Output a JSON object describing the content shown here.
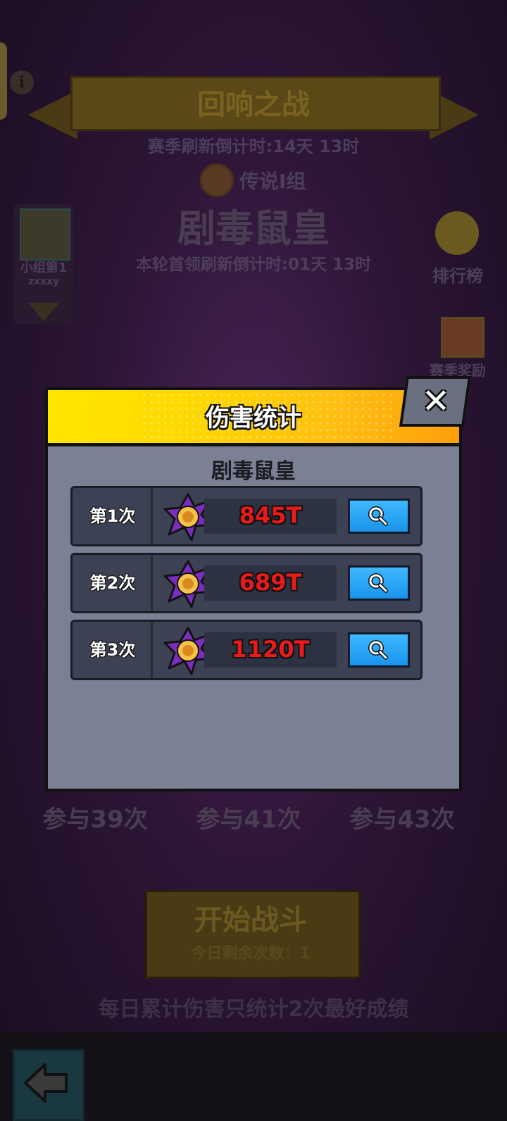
{
  "background": {
    "banner_title": "回响之战",
    "season_countdown": "赛季刷新倒计时:14天 13时",
    "group_label": "传说I组",
    "boss_name": "剧毒鼠皇",
    "leader_countdown": "本轮首领刷新倒计时:01天 13时",
    "group_rank": "小组第1",
    "group_user": "zxxxy",
    "ranking_label": "排行榜",
    "season_reward_label": "赛季奖励",
    "participations": [
      "参与39次",
      "参与41次",
      "参与43次"
    ],
    "start_button": "开始战斗",
    "remaining_today": "今日剩余次数：1",
    "daily_note": "每日累计伤害只统计2次最好成绩"
  },
  "modal": {
    "title": "伤害统计",
    "close_label": "✕",
    "subtitle": "剧毒鼠皇",
    "rows": [
      {
        "label": "第1次",
        "damage": "845T"
      },
      {
        "label": "第2次",
        "damage": "689T"
      },
      {
        "label": "第3次",
        "damage": "1120T"
      }
    ]
  },
  "colors": {
    "header_yellow": "#ffe600",
    "header_orange": "#ff9e0a",
    "damage_red": "#e81a1a",
    "search_blue": "#1a94ec",
    "panel_gray": "#7b8195"
  },
  "icons": [
    "info-icon",
    "rank-shield-icon",
    "ranking-medal-icon",
    "gift-icon",
    "close-icon",
    "star-burst-icon",
    "magnifier-icon",
    "back-arrow-icon"
  ]
}
